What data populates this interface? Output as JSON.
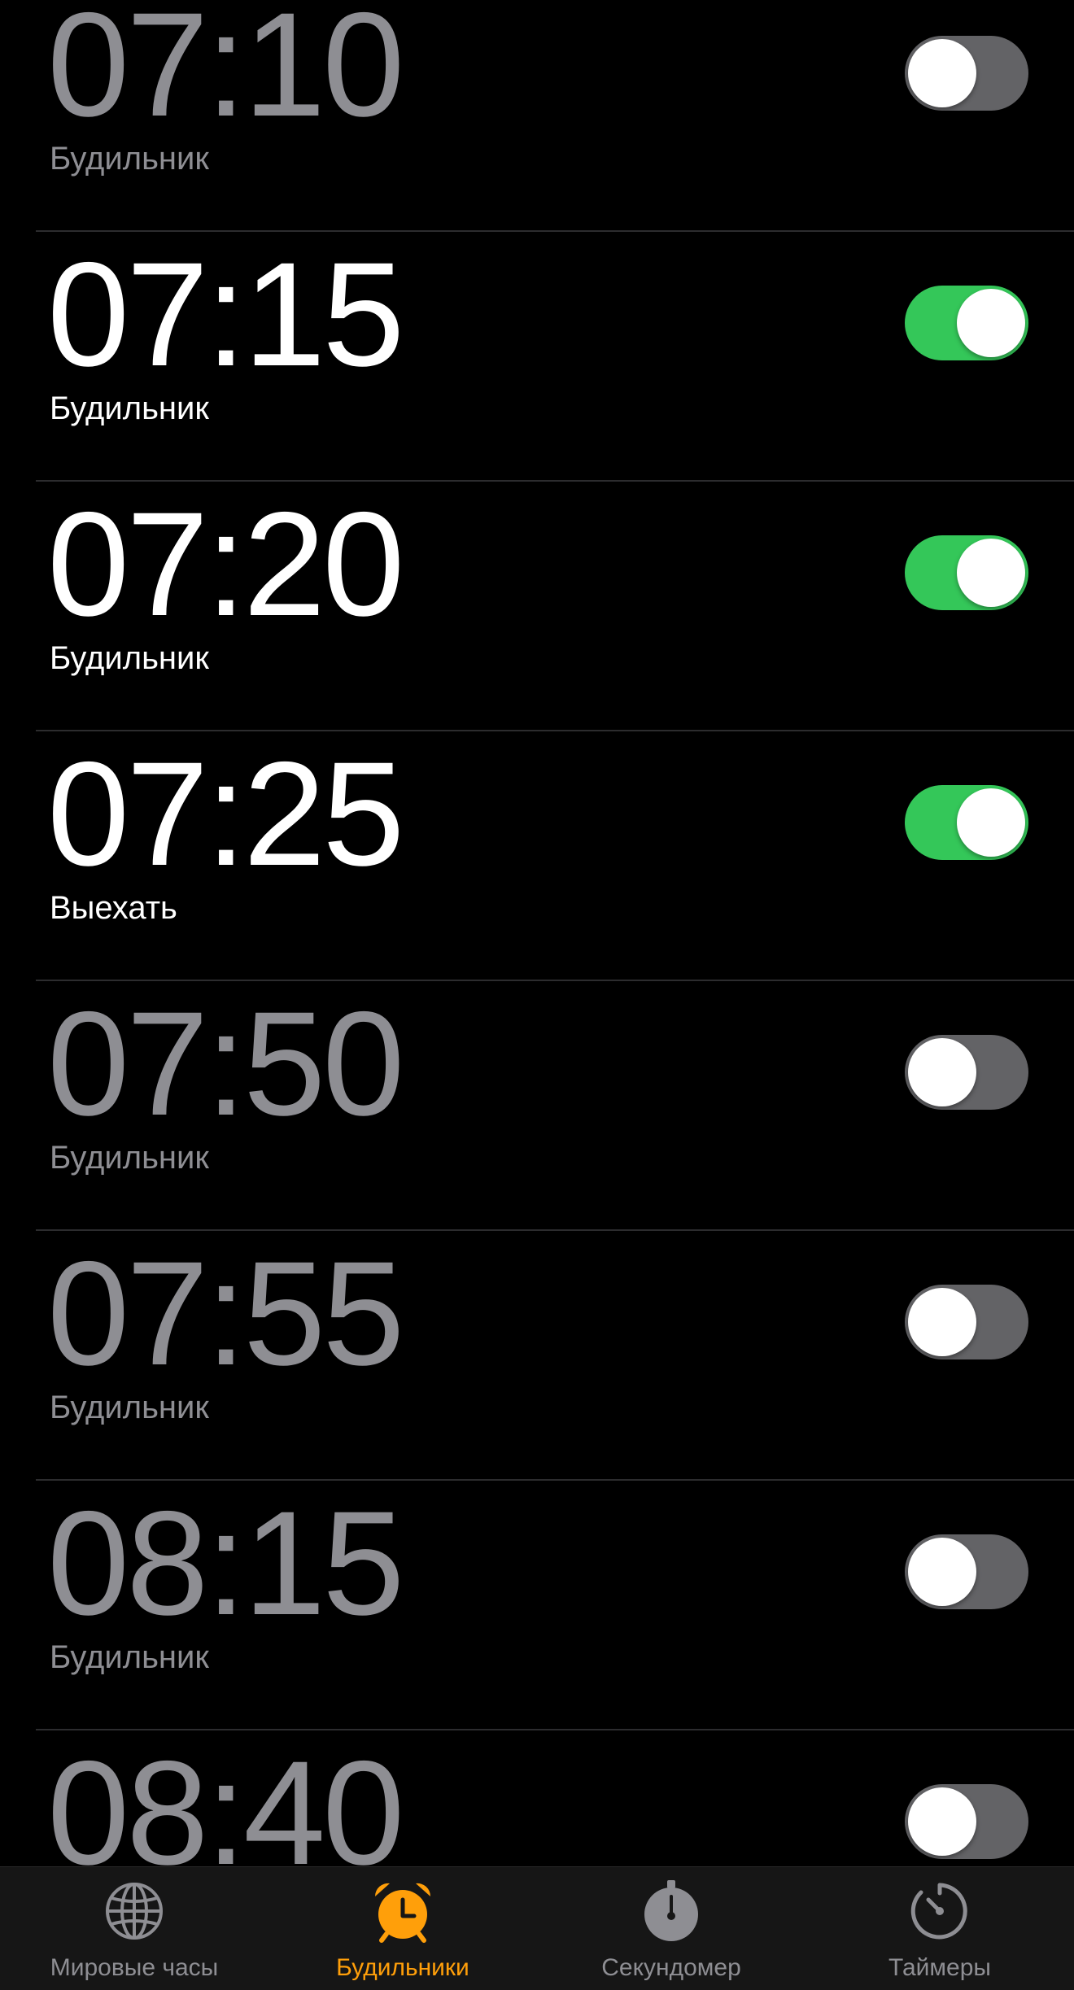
{
  "alarms": [
    {
      "time": "07:10",
      "label": "Будильник",
      "enabled": false
    },
    {
      "time": "07:15",
      "label": "Будильник",
      "enabled": true
    },
    {
      "time": "07:20",
      "label": "Будильник",
      "enabled": true
    },
    {
      "time": "07:25",
      "label": "Выехать",
      "enabled": true
    },
    {
      "time": "07:50",
      "label": "Будильник",
      "enabled": false
    },
    {
      "time": "07:55",
      "label": "Будильник",
      "enabled": false
    },
    {
      "time": "08:15",
      "label": "Будильник",
      "enabled": false
    },
    {
      "time": "08:40",
      "label": "",
      "enabled": false
    }
  ],
  "tabs": [
    {
      "label": "Мировые часы",
      "icon": "globe-icon",
      "active": false
    },
    {
      "label": "Будильники",
      "icon": "alarm-clock-icon",
      "active": true
    },
    {
      "label": "Секундомер",
      "icon": "stopwatch-icon",
      "active": false
    },
    {
      "label": "Таймеры",
      "icon": "timer-icon",
      "active": false
    }
  ],
  "colors": {
    "background": "#000000",
    "accent": "#ff9f0a",
    "toggle_on": "#34c759",
    "toggle_off": "#636366",
    "inactive_text": "#8e8e93"
  }
}
